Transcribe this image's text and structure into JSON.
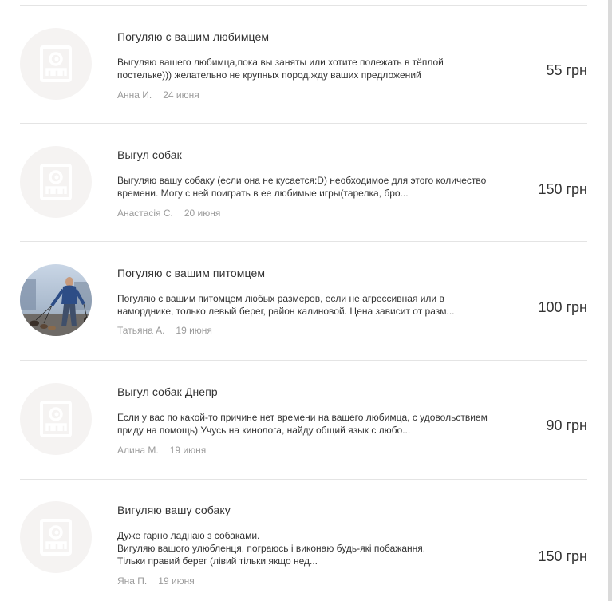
{
  "listings": [
    {
      "title": "Погуляю с вашим любимцем",
      "description": [
        "Выгуляю вашего любимца,пока вы заняты или хотите полежать в тёплой",
        "постельке))) желательно не крупных пород.жду ваших предложений"
      ],
      "author": "Анна И.",
      "date": "24 июня",
      "price": "55 грн",
      "avatar": "placeholder-logo"
    },
    {
      "title": "Выгул собак",
      "description": [
        "Выгуляю вашу собаку (если она не кусается:D) необходимое для этого количество",
        "времени. Могу с ней поиграть в ее любимые игры(тарелка, бро..."
      ],
      "author": "Анастасія С.",
      "date": "20 июня",
      "price": "150 грн",
      "avatar": "placeholder-logo"
    },
    {
      "title": "Погуляю с вашим питомцем",
      "description": [
        "Погуляю с вашим питомцем любых размеров, если не агрессивная или в",
        "наморднике, только левый берег, район калиновой. Цена зависит от разм..."
      ],
      "author": "Татьяна А.",
      "date": "19 июня",
      "price": "100 грн",
      "avatar": "photo-dog-walker"
    },
    {
      "title": "Выгул собак Днепр",
      "description": [
        "Если у вас по какой-то причине нет времени на вашего любимца, с удовольствием",
        "приду на помощь) Учусь на кинолога, найду общий язык с любо..."
      ],
      "author": "Алина М.",
      "date": "19 июня",
      "price": "90 грн",
      "avatar": "placeholder-logo"
    },
    {
      "title": "Вигуляю вашу собаку",
      "description": [
        "Дуже гарно ладнаю з собаками.",
        "Вигуляю вашого улюбленця, пограюсь і виконаю будь-які побажання.",
        "Тільки правий берег (лівий тільки якщо нед..."
      ],
      "author": "Яна П.",
      "date": "19 июня",
      "price": "150 грн",
      "avatar": "placeholder-logo"
    }
  ]
}
